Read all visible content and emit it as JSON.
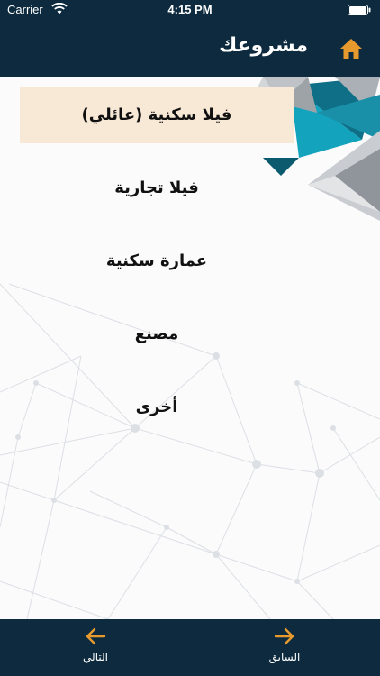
{
  "status_bar": {
    "carrier": "Carrier",
    "time": "4:15 PM"
  },
  "header": {
    "title": "مشروعك",
    "home_icon": "home-icon"
  },
  "options": [
    {
      "label": "فيلا سكنية (عائلي)",
      "selected": true
    },
    {
      "label": "فيلا تجارية",
      "selected": false
    },
    {
      "label": "عمارة سكنية",
      "selected": false
    },
    {
      "label": "مصنع",
      "selected": false
    },
    {
      "label": "أخرى",
      "selected": false
    }
  ],
  "footer": {
    "next_label": "التالي",
    "prev_label": "السابق"
  },
  "colors": {
    "header_bg": "#0d2a3e",
    "accent": "#e69a2d",
    "selected_bg": "#f8e8d6"
  }
}
